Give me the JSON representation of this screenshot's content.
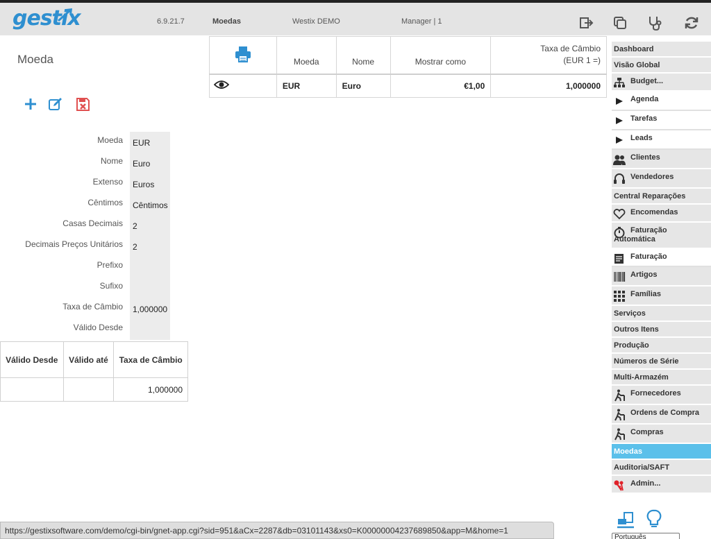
{
  "header": {
    "logo": "gestix",
    "version": "6.9.21.7",
    "module": "Moedas",
    "company": "Westix DEMO",
    "user": "Manager | 1"
  },
  "page": {
    "title": "Moeda"
  },
  "form": {
    "rows": [
      {
        "label": "Moeda",
        "value": "EUR"
      },
      {
        "label": "Nome",
        "value": "Euro"
      },
      {
        "label": "Extenso",
        "value": "Euros"
      },
      {
        "label": "Cêntimos",
        "value": "Cêntimos"
      },
      {
        "label": "Casas Decimais",
        "value": "2"
      },
      {
        "label": "Decimais Preços Unitários",
        "value": "2"
      },
      {
        "label": "Prefixo",
        "value": ""
      },
      {
        "label": "Sufixo",
        "value": ""
      },
      {
        "label": "Taxa de Câmbio",
        "value": "1,000000"
      },
      {
        "label": "Válido Desde",
        "value": ""
      }
    ]
  },
  "history_table": {
    "headers": [
      "Válido Desde",
      "Válido até",
      "Taxa de Câmbio"
    ],
    "rows": [
      [
        "",
        "",
        "1,000000"
      ]
    ]
  },
  "main_table": {
    "headers": [
      "",
      "Moeda",
      "Nome",
      "Mostrar como",
      "Taxa de Câmbio (EUR 1 =)"
    ],
    "header_rate_line1": "Taxa de Câmbio",
    "header_rate_line2": "(EUR 1 =)",
    "rows": [
      {
        "code": "EUR",
        "name": "Euro",
        "display": "€1,00",
        "rate": "1,000000"
      }
    ]
  },
  "sidebar": {
    "items": [
      {
        "label": "Dashboard"
      },
      {
        "label": "Visão Global"
      },
      {
        "label": "Budget...",
        "icon": "org-chart-icon"
      },
      {
        "label": "Agenda",
        "icon": "play-icon"
      },
      {
        "label": "Tarefas",
        "icon": "play-icon"
      },
      {
        "label": "Leads",
        "icon": "play-icon"
      },
      {
        "label": "Clientes",
        "icon": "users-icon"
      },
      {
        "label": "Vendedores",
        "icon": "headset-icon"
      },
      {
        "label": "Central Reparações"
      },
      {
        "label": "Encomendas",
        "icon": "heart-icon"
      },
      {
        "label": "Faturação Automática",
        "icon": "stopwatch-icon"
      },
      {
        "label": "Faturação",
        "icon": "document-icon"
      },
      {
        "label": "Artigos",
        "icon": "barcode-icon"
      },
      {
        "label": "Famílias",
        "icon": "grid-icon"
      },
      {
        "label": "Serviços"
      },
      {
        "label": "Outros Itens"
      },
      {
        "label": "Produção"
      },
      {
        "label": "Números de Série"
      },
      {
        "label": "Multi-Armazém"
      },
      {
        "label": "Fornecedores",
        "icon": "walker-icon"
      },
      {
        "label": "Ordens de Compra",
        "icon": "walker-icon"
      },
      {
        "label": "Compras",
        "icon": "walker-icon"
      },
      {
        "label": "Moedas"
      },
      {
        "label": "Auditoria/SAFT"
      },
      {
        "label": "Admin...",
        "icon": "keys-icon"
      }
    ]
  },
  "status_bar": {
    "url": "https://gestixsoftware.com/demo/cgi-bin/gnet-app.cgi?sid=951&aCx=2287&db=03101143&xs0=K00000004237689850&app=M&home=1"
  },
  "language_select": {
    "value": "Português"
  },
  "colors": {
    "accent": "#2e8fd0",
    "active_menu": "#5bc0ea",
    "delete_red": "#e05050"
  }
}
